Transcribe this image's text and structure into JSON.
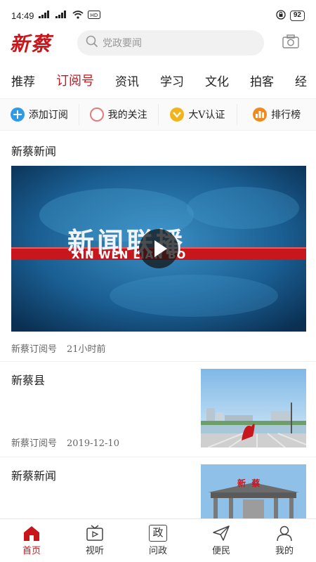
{
  "status": {
    "time": "14:49",
    "signal1": "4G",
    "signal2": "4G",
    "battery": "92"
  },
  "header": {
    "logo": "新蔡",
    "search_placeholder": "党政要闻"
  },
  "tabs": [
    {
      "label": "推荐"
    },
    {
      "label": "订阅号"
    },
    {
      "label": "资讯"
    },
    {
      "label": "学习"
    },
    {
      "label": "文化"
    },
    {
      "label": "拍客"
    },
    {
      "label": "经"
    }
  ],
  "quick_actions": [
    {
      "label": "添加订阅",
      "icon": "plus-icon",
      "color": "#2e9be6"
    },
    {
      "label": "我的关注",
      "icon": "circle-icon",
      "color": "#e47b7b"
    },
    {
      "label": "大V认证",
      "icon": "v-badge-icon",
      "color": "#f2b31b"
    },
    {
      "label": "排行榜",
      "icon": "bar-chart-icon",
      "color": "#f08a1d"
    }
  ],
  "feed": [
    {
      "title": "新蔡新闻",
      "source": "新蔡订阅号",
      "time": "21小时前",
      "video_title": "新闻联播",
      "video_subtitle": "XIN WEN LIAN BO"
    },
    {
      "title": "新蔡县",
      "source": "新蔡订阅号",
      "time": "2019-12-10"
    },
    {
      "title": "新蔡新闻",
      "thumb_sign": "新  蔡"
    }
  ],
  "bottom_nav": [
    {
      "label": "首页",
      "icon": "home-icon"
    },
    {
      "label": "视听",
      "icon": "tv-icon"
    },
    {
      "label": "问政",
      "icon": "zheng-icon",
      "glyph": "政"
    },
    {
      "label": "便民",
      "icon": "send-icon"
    },
    {
      "label": "我的",
      "icon": "person-icon"
    }
  ],
  "colors": {
    "accent": "#c8161d",
    "text": "#222222",
    "meta": "#666666"
  }
}
